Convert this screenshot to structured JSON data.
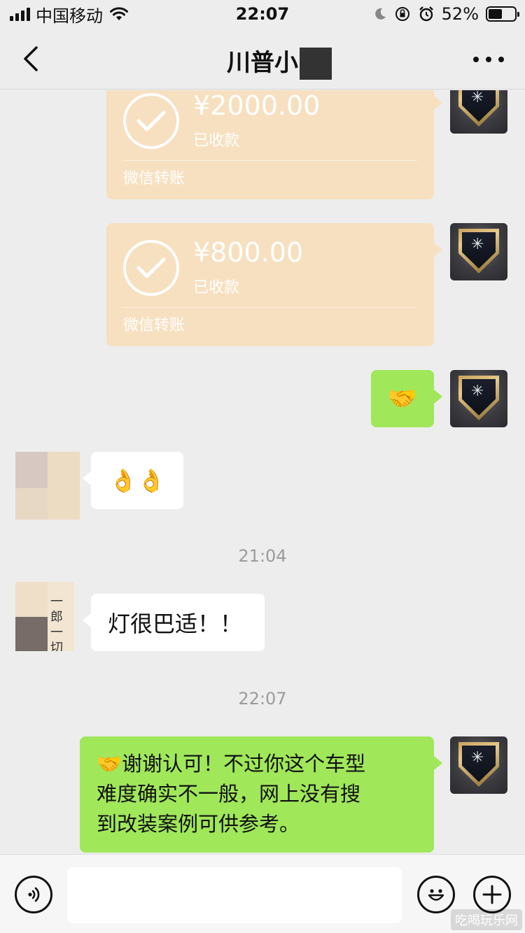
{
  "status_bar": {
    "carrier": "中国移动",
    "time": "22:07",
    "battery": "52%"
  },
  "nav": {
    "title": "川普小"
  },
  "messages": [
    {
      "type": "transfer",
      "amount": "¥2000.00",
      "status": "已收款",
      "footer": "微信转账"
    },
    {
      "type": "transfer",
      "amount": "¥800.00",
      "status": "已收款",
      "footer": "微信转账"
    },
    {
      "type": "text_out",
      "text": "🤝"
    },
    {
      "type": "text_in",
      "text": "👌👌"
    },
    {
      "type": "time",
      "text": "21:04"
    },
    {
      "type": "text_in",
      "text": "灯很巴适！！"
    },
    {
      "type": "time",
      "text": "22:07"
    },
    {
      "type": "text_out",
      "lines": [
        "🤝谢谢认可！不过你这个车型",
        "难度确实不一般，网上没有搜",
        "到改装案例可供参考。"
      ]
    }
  ],
  "input_bar": {
    "placeholder": ""
  },
  "watermark": "吃喝玩乐网",
  "colors": {
    "background": "#ededed",
    "transfer_card": "#f7e0c0",
    "sent_bubble": "#a0e75a",
    "received_bubble": "#ffffff"
  },
  "icons": [
    "back-arrow-icon",
    "more-icon",
    "check-icon",
    "voice-icon",
    "emoji-icon",
    "plus-icon",
    "wifi-icon",
    "signal-icon",
    "battery-icon",
    "moon-icon",
    "lock-rotation-icon",
    "alarm-icon"
  ]
}
